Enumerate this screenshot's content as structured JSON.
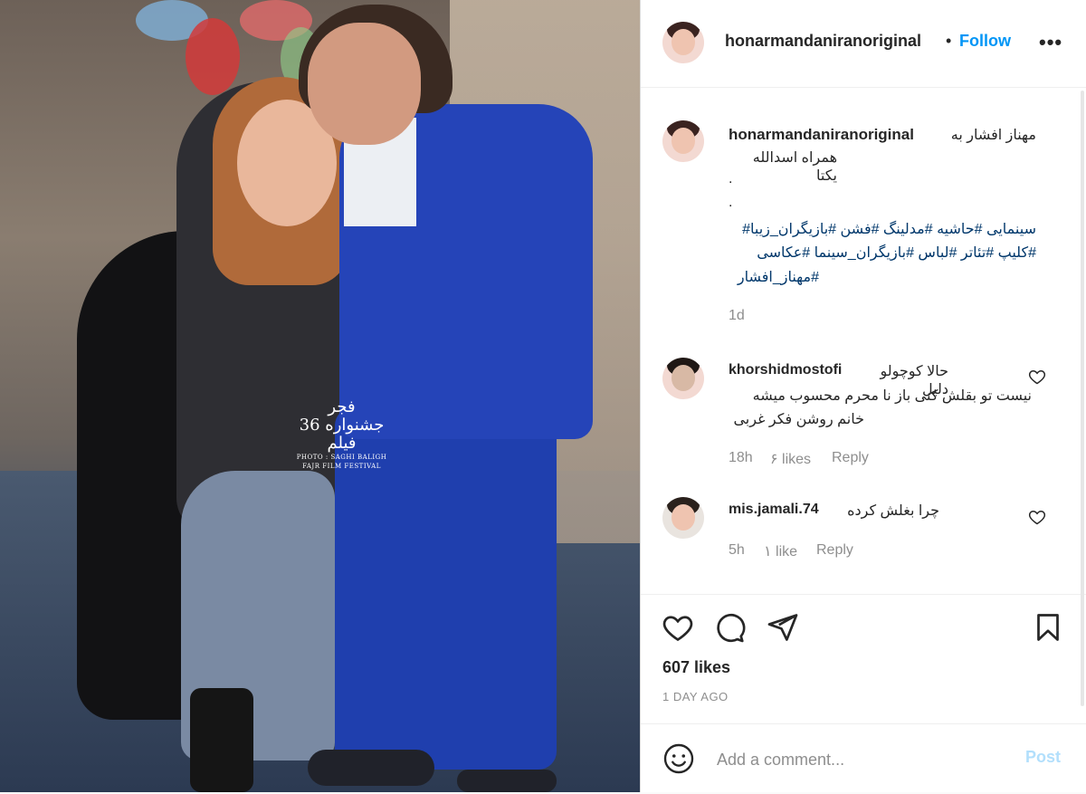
{
  "post": {
    "username": "honarmandaniranoriginal",
    "dot": "•",
    "follow_label": "Follow",
    "more_label": "•••"
  },
  "caption": {
    "username": "honarmandaniranoriginal",
    "line1": "مهناز افشار به",
    "line2": "همراه اسدالله یکتا",
    "dot": ".",
    "hashtags": [
      "سینمایی #حاشیه #مدلینگ #فشن #بازیگران_زیبا#",
      "#کلیپ #تئاتر #لباس #بازیگران_سینما #عکاسی",
      "#مهناز_افشار"
    ],
    "time": "1d"
  },
  "comments": [
    {
      "username": "khorshidmostofi",
      "lines": [
        "حالا کوچولو دلیل",
        "نیست تو بقلش کنی باز نا محرم محسوب میشه",
        "خانم روشن فکر غربی"
      ],
      "time": "18h",
      "likes": "۶ likes",
      "reply": "Reply"
    },
    {
      "username": "mis.jamali.74",
      "lines": [
        "چرا بغلش کرده"
      ],
      "time": "5h",
      "likes": "۱ like",
      "reply": "Reply"
    }
  ],
  "watermark": {
    "line1": "فجر",
    "line2": "جشنواره 36",
    "line3": "فیلم",
    "credit1": "PHOTO : SAGHI BALIGH",
    "credit2": "FAJR FILM FESTIVAL"
  },
  "footer": {
    "likes": "607 likes",
    "time": "1 DAY AGO",
    "comment_placeholder": "Add a comment...",
    "post_label": "Post"
  },
  "icons": {
    "heart": "heart-icon",
    "comment": "comment-icon",
    "share": "paper-plane-icon",
    "save": "bookmark-icon",
    "emoji": "emoji-icon",
    "more": "more-options-icon"
  },
  "colors": {
    "link": "#0095f6",
    "hashtag": "#00376b",
    "muted": "#8e8e8e",
    "post_disabled": "#b2dffc"
  }
}
